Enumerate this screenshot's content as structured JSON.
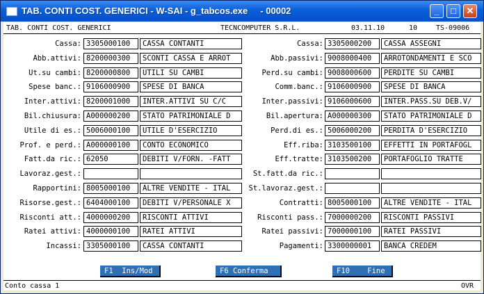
{
  "window": {
    "title": "TAB. CONTI COST. GENERICI - W-SAI - g_tabcos.exe     - 00002",
    "controls": {
      "minimize": "minimize-icon",
      "maximize": "maximize-icon",
      "close": "close-icon"
    }
  },
  "header": {
    "form_name": "TAB. CONTI COST. GENERICI",
    "company": "TECNCOMPUTER S.R.L.",
    "date": "03.11.10",
    "number": "10",
    "code": "TS-09006"
  },
  "left": [
    {
      "label": "Cassa:",
      "code": "3305000100",
      "desc": "CASSA CONTANTI"
    },
    {
      "label": "Abb.attivi:",
      "code": "8200000300",
      "desc": "SCONTI CASSA E ARROT"
    },
    {
      "label": "Ut.su cambi:",
      "code": "8200000800",
      "desc": "UTILI SU CAMBI"
    },
    {
      "label": "Spese banc.:",
      "code": "9106000900",
      "desc": "SPESE DI BANCA"
    },
    {
      "label": "Inter.attivi:",
      "code": "8200001000",
      "desc": "INTER.ATTIVI SU C/C"
    },
    {
      "label": "Bil.chiusura:",
      "code": "A000000200",
      "desc": "STATO PATRIMONIALE D"
    },
    {
      "label": "Utile di es.:",
      "code": "5006000100",
      "desc": "UTILE D'ESERCIZIO"
    },
    {
      "label": "Prof. e perd.:",
      "code": "A000000100",
      "desc": "CONTO ECONOMICO"
    },
    {
      "label": "Fatt.da ric.:",
      "code": "62050",
      "desc": "DEBITI V/FORN. -FATT"
    },
    {
      "label": "Lavoraz.gest.:",
      "code": "",
      "desc": ""
    },
    {
      "label": "Rapportini:",
      "code": "8005000100",
      "desc": "ALTRE VENDITE - ITAL"
    },
    {
      "label": "Risorse.gest.:",
      "code": "6404000100",
      "desc": "DEBITI V/PERSONALE X"
    },
    {
      "label": "Risconti att.:",
      "code": "4000000200",
      "desc": "RISCONTI ATTIVI"
    },
    {
      "label": "Ratei attivi:",
      "code": "4000000100",
      "desc": "RATEI ATTIVI"
    },
    {
      "label": "Incassi:",
      "code": "3305000100",
      "desc": "CASSA CONTANTI"
    }
  ],
  "right": [
    {
      "label": "Cassa:",
      "code": "3305000200",
      "desc": "CASSA ASSEGNI"
    },
    {
      "label": "Abb.passivi:",
      "code": "9008000400",
      "desc": "ARROTONDAMENTI E SCO"
    },
    {
      "label": "Perd.su cambi:",
      "code": "9008000600",
      "desc": "PERDITE SU CAMBI"
    },
    {
      "label": "Comm.banc.:",
      "code": "9106000900",
      "desc": "SPESE DI BANCA"
    },
    {
      "label": "Inter.passivi:",
      "code": "9106000600",
      "desc": "INTER.PASS.SU DEB.V/"
    },
    {
      "label": "Bil.apertura:",
      "code": "A000000300",
      "desc": "STATO PATRIMONIALE D"
    },
    {
      "label": "Perd.di es.:",
      "code": "5006000200",
      "desc": "PERDITA D'ESERCIZIO"
    },
    {
      "label": "Eff.riba:",
      "code": "3103500100",
      "desc": "EFFETTI IN PORTAFOGL"
    },
    {
      "label": "Eff.tratte:",
      "code": "3103500200",
      "desc": "PORTAFOGLIO TRATTE"
    },
    {
      "label": "St.fatt.da ric.:",
      "code": "",
      "desc": ""
    },
    {
      "label": "St.lavoraz.gest.:",
      "code": "",
      "desc": ""
    },
    {
      "label": "Contratti:",
      "code": "8005000100",
      "desc": "ALTRE VENDITE - ITAL"
    },
    {
      "label": "Risconti pass.:",
      "code": "7000000200",
      "desc": "RISCONTI PASSIVI"
    },
    {
      "label": "Ratei passivi:",
      "code": "7000000100",
      "desc": "RATEI PASSIVI"
    },
    {
      "label": "Pagamenti:",
      "code": "3300000001",
      "desc": "BANCA CREDEM"
    }
  ],
  "fkeys": [
    {
      "label": "F1  Ins/Mod"
    },
    {
      "label": "F6 Conferma"
    },
    {
      "label": "F10    Fine"
    }
  ],
  "status": {
    "message": "Conto cassa 1",
    "mode": "OVR"
  }
}
